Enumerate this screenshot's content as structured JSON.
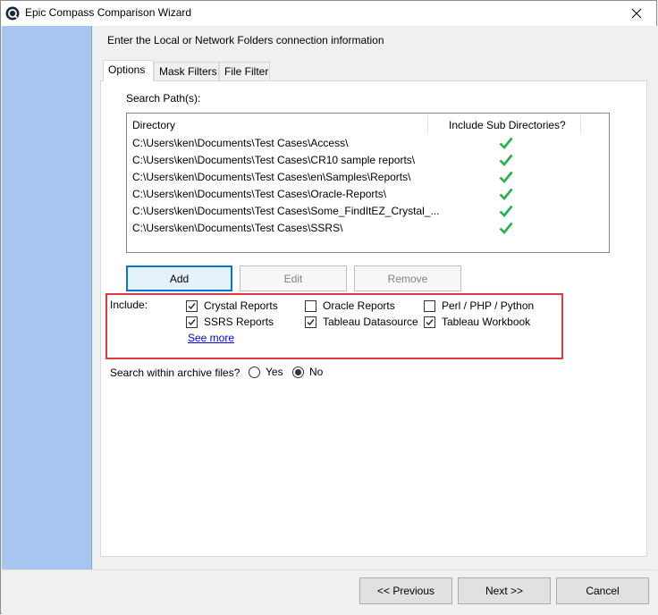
{
  "window": {
    "title": "Epic Compass Comparison Wizard",
    "close_glyph": "✕"
  },
  "header": {
    "text": "Enter the Local or Network Folders connection information"
  },
  "tabs": [
    {
      "label": "Options",
      "active": true
    },
    {
      "label": "Mask Filters",
      "active": false
    },
    {
      "label": "File Filter",
      "active": false
    }
  ],
  "search": {
    "label": "Search Path(s):",
    "columns": [
      "Directory",
      "Include Sub Directories?"
    ],
    "rows": [
      {
        "path": "C:\\Users\\ken\\Documents\\Test Cases\\Access\\",
        "include_sub": true
      },
      {
        "path": "C:\\Users\\ken\\Documents\\Test Cases\\CR10 sample reports\\",
        "include_sub": true
      },
      {
        "path": "C:\\Users\\ken\\Documents\\Test Cases\\en\\Samples\\Reports\\",
        "include_sub": true
      },
      {
        "path": "C:\\Users\\ken\\Documents\\Test Cases\\Oracle-Reports\\",
        "include_sub": true
      },
      {
        "path": "C:\\Users\\ken\\Documents\\Test Cases\\Some_FindItEZ_Crystal_...",
        "include_sub": true
      },
      {
        "path": "C:\\Users\\ken\\Documents\\Test Cases\\SSRS\\",
        "include_sub": true
      }
    ],
    "check_color": "#22b14c"
  },
  "list_buttons": {
    "add": "Add",
    "edit": "Edit",
    "remove": "Remove"
  },
  "include": {
    "label": "Include:",
    "options": [
      {
        "label": "Crystal Reports",
        "checked": true
      },
      {
        "label": "Oracle Reports",
        "checked": false
      },
      {
        "label": "Perl / PHP / Python",
        "checked": false
      },
      {
        "label": "SSRS Reports",
        "checked": true
      },
      {
        "label": "Tableau Datasource",
        "checked": true
      },
      {
        "label": "Tableau Workbook",
        "checked": true
      }
    ],
    "see_more": "See more",
    "highlight_color": "#e0383f"
  },
  "archive": {
    "label": "Search within archive files?",
    "options": [
      {
        "label": "Yes",
        "selected": false
      },
      {
        "label": "No",
        "selected": true
      }
    ]
  },
  "footer": {
    "previous": "<< Previous",
    "next": "Next >>",
    "cancel": "Cancel"
  },
  "colors": {
    "sidebar": "#a6c5ef",
    "accent": "#0078d7"
  }
}
